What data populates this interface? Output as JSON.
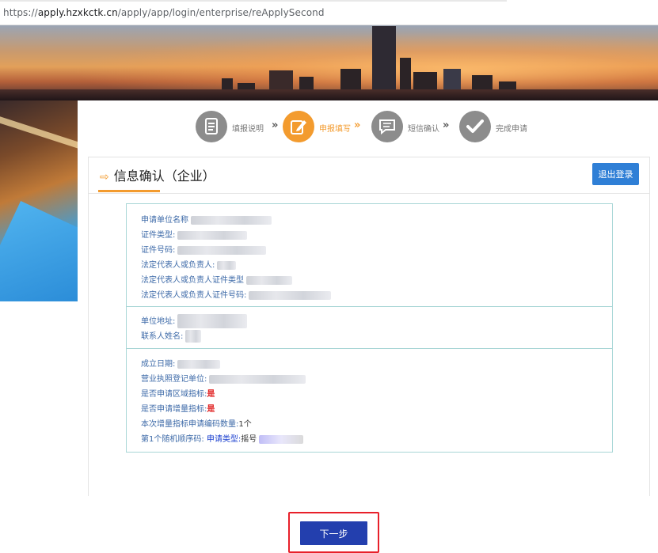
{
  "browser": {
    "url_prefix": "https://",
    "url_host": "apply.hzxkctk.cn",
    "url_path": "/apply/app/login/enterprise/reApplySecond"
  },
  "steps": [
    {
      "label": "填报说明",
      "icon": "document-icon",
      "active": false
    },
    {
      "label": "申报填写",
      "icon": "edit-icon",
      "active": true
    },
    {
      "label": "短信确认",
      "icon": "message-icon",
      "active": false
    },
    {
      "label": "完成申请",
      "icon": "check-icon",
      "active": false
    }
  ],
  "card": {
    "title": "信息确认（企业）",
    "logout_label": "退出登录"
  },
  "info": {
    "section1": [
      {
        "label": "申请单位名称"
      },
      {
        "label": "证件类型:"
      },
      {
        "label": "证件号码:"
      },
      {
        "label": "法定代表人或负责人:"
      },
      {
        "label": "法定代表人或负责人证件类型"
      },
      {
        "label": "法定代表人或负责人证件号码:"
      }
    ],
    "section2": [
      {
        "label": "单位地址:"
      },
      {
        "label": "联系人姓名:"
      }
    ],
    "section3": {
      "established": "成立日期:",
      "registration_unit": "营业执照登记单位:",
      "regional_indicator_label": "是否申请区域指标:",
      "regional_indicator_value": "是",
      "increment_indicator_label": "是否申请增量指标:",
      "increment_indicator_value": "是",
      "code_count_label": "本次增量指标申请编码数量:",
      "code_count_value": "1个",
      "random_seq_label": "第1个随机顺序码:",
      "apply_type_label": "申请类型:",
      "apply_type_value": "摇号"
    }
  },
  "next_label": "下一步",
  "colors": {
    "accent": "#f39b2e",
    "primary_button": "#2f7fd6",
    "next_button": "#233fae",
    "highlight_border": "#e8202a",
    "yes_red": "#e02020"
  }
}
